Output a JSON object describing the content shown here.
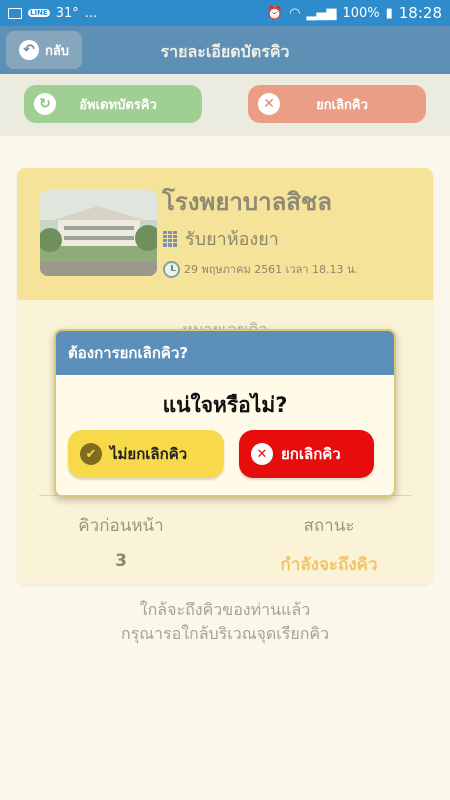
{
  "status_bar": {
    "left_text": "31°",
    "dots": "...",
    "battery": "100%",
    "time": "18:28"
  },
  "header": {
    "back_label": "กลับ",
    "title": "รายละเอียดบัตรคิว"
  },
  "actions": {
    "update_label": "อัพเดทบัตรคิว",
    "cancel_label": "ยกเลิกคิว"
  },
  "card": {
    "hospital_name": "โรงพยาบาลสิชล",
    "service": "รับยาห้องยา",
    "datetime": "29 พฤษภาคม 2561 เวลา 18.13 น.",
    "queue_label": "หมายเลขคิว",
    "queue_before_label": "คิวก่อนหน้า",
    "queue_before_value": "3",
    "status_label": "สถานะ",
    "status_value": "กำลังจะถึงคิว"
  },
  "notice": {
    "line1": "ใกล้จะถึงคิวของท่านแล้ว",
    "line2": "กรุณารอใกล้บริเวณจุดเรียกคิว"
  },
  "dialog": {
    "title": "ต้องการยกเลิกคิว?",
    "question": "แน่ใจหรือไม่?",
    "keep_label": "ไม่ยกเลิกคิว",
    "confirm_label": "ยกเลิกคิว"
  },
  "colors": {
    "status_bar": "#2f8ccc",
    "header": "#5e8fb4",
    "update_button": "#9fcf93",
    "cancel_button": "#ec9d86",
    "card_top": "#f6e39a",
    "status_accent": "#f1c56a",
    "dialog_header": "#5d8fbb",
    "keep_button": "#f7d94a",
    "confirm_button": "#e80d0d"
  }
}
